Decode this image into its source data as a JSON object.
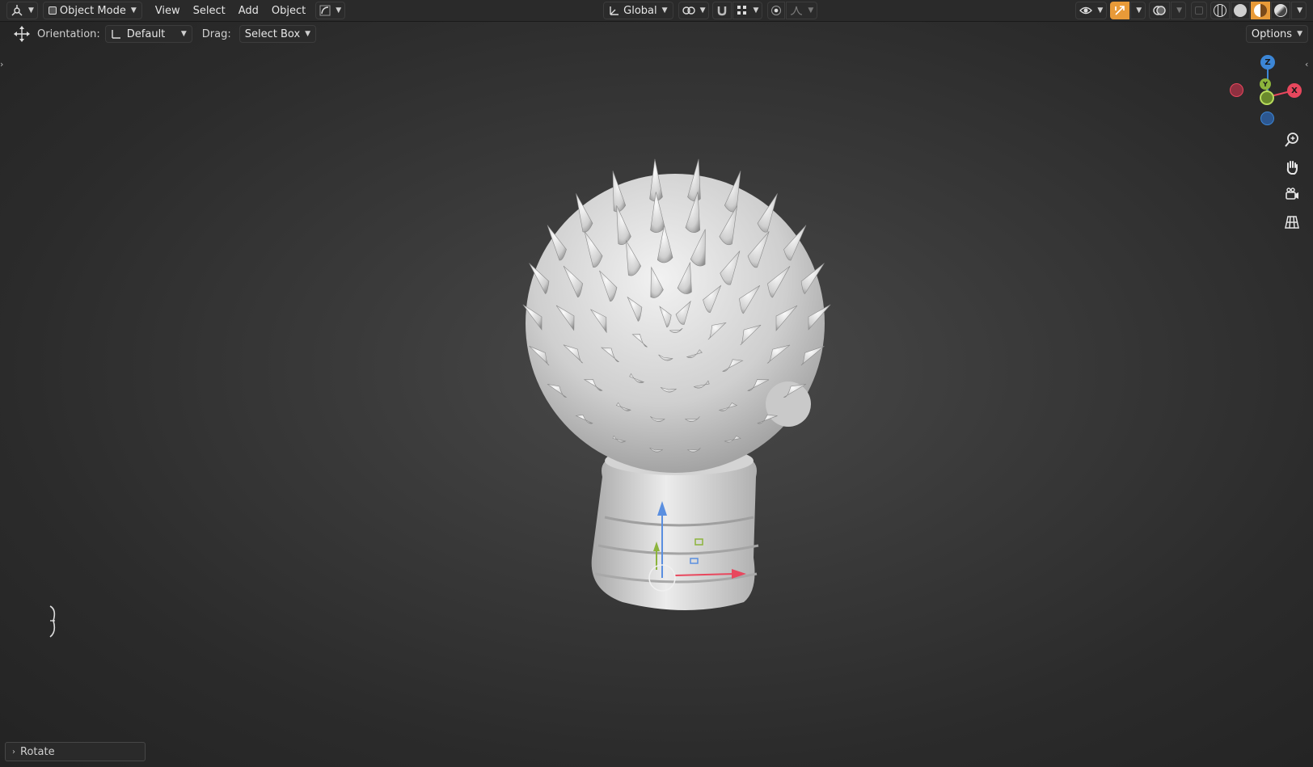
{
  "header": {
    "editor_type_icon": "3d-viewport-icon",
    "mode_label": "Object Mode",
    "menus": [
      "View",
      "Select",
      "Add",
      "Object"
    ],
    "transform_orientation": "Global"
  },
  "tool_settings": {
    "orientation_label": "Orientation:",
    "orientation_value": "Default",
    "drag_label": "Drag:",
    "drag_value": "Select Box",
    "options_label": "Options"
  },
  "gizmo": {
    "z_label": "Z",
    "y_label": "Y",
    "x_label": "X",
    "colors": {
      "x": "#e8475d",
      "y": "#8cb43c",
      "z": "#3c86d6"
    }
  },
  "last_operator": {
    "label": "Rotate"
  },
  "colors": {
    "accent_orange": "#e89a38",
    "viewport_bg": "#383838",
    "model": "#d9d9d9"
  }
}
